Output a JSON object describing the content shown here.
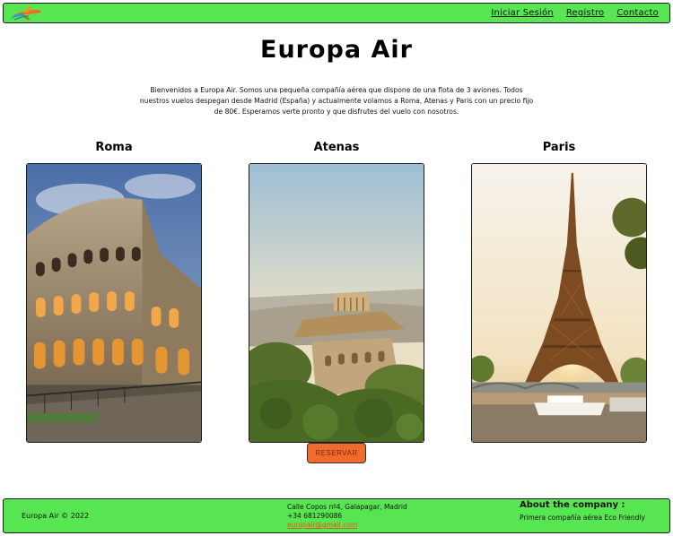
{
  "nav": {
    "logo_icon": "plane-logo-icon",
    "links": [
      "Iniciar Sesión",
      "Registro",
      "Contacto"
    ]
  },
  "main": {
    "title": "Europa Air",
    "intro": "Bienvenidos a Europa Air. Somos una pequeña compañía aérea que dispone de una flota de 3 aviones. Todos nuestros vuelos despegan desde Madrid (España) y actualmente volamos a Roma, Atenas y Paris con un precio fijo de 80€. Esperamos verte pronto y que disfrutes del vuelo con nosotros.",
    "cities": [
      {
        "name": "Roma",
        "image": "colosseum-photo"
      },
      {
        "name": "Atenas",
        "image": "acropolis-photo"
      },
      {
        "name": "Paris",
        "image": "eiffel-tower-photo"
      }
    ],
    "reserve_label": "RESERVAR"
  },
  "footer": {
    "copyright": "Europa Air © 2022",
    "address": "Calle Copos nº4, Galapagar, Madrid",
    "phone": "+34 681290086",
    "email": "europair@gmail.com",
    "about_title": "About the company :",
    "about_text": "Primera compañía aérea Eco Friendly"
  },
  "colors": {
    "bar_green": "#58e552",
    "button_orange": "#f06b2d",
    "link_orange": "#e8531a"
  }
}
